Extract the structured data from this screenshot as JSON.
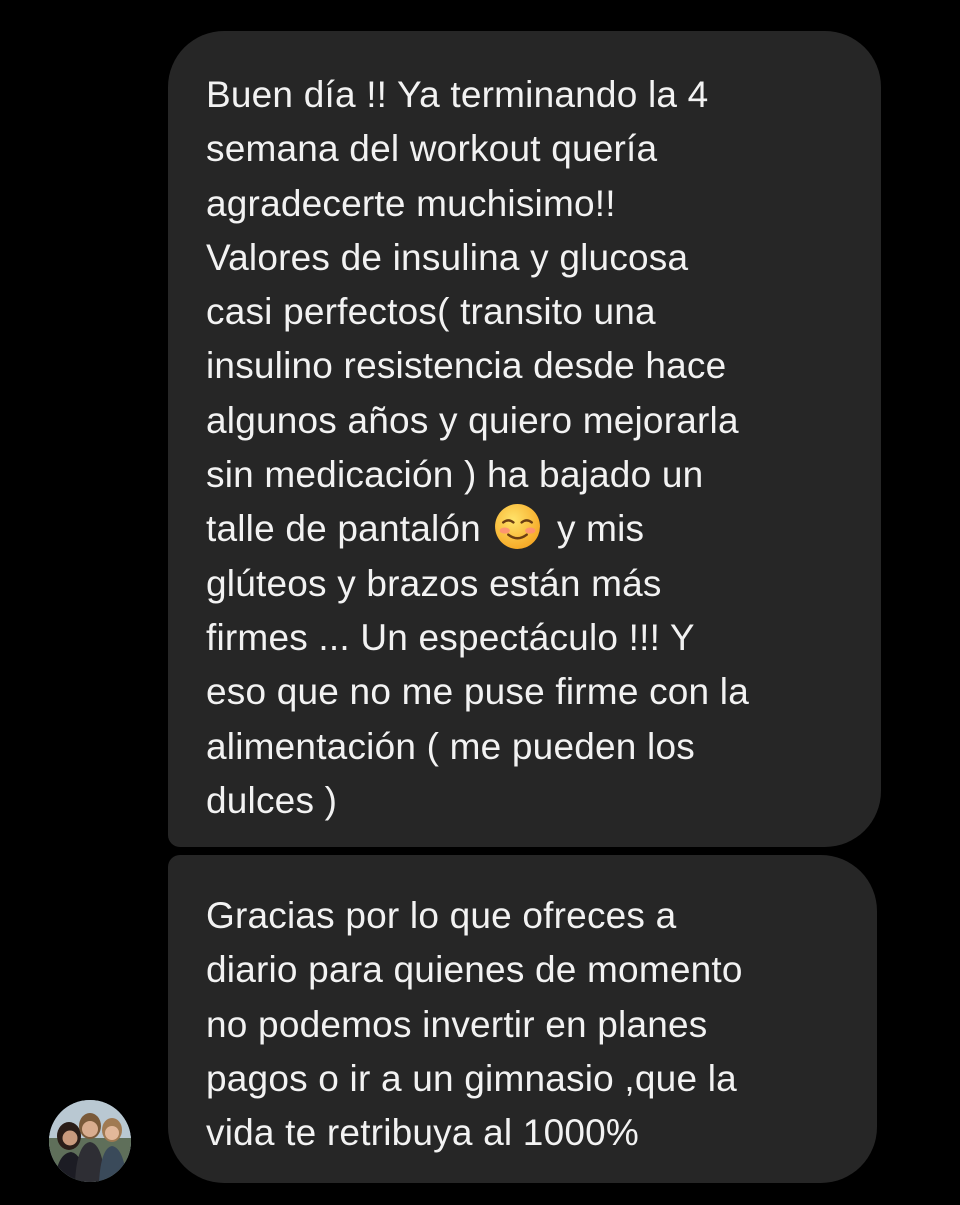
{
  "conversation": {
    "messages": [
      {
        "lines": [
          "Buen día !! Ya terminando la 4",
          "semana del workout quería",
          "agradecerte muchisimo!!",
          "Valores de insulina y glucosa",
          "casi perfectos( transito una",
          "insulino resistencia desde hace",
          "algunos años y quiero mejorarla",
          "sin medicación ) ha bajado un"
        ],
        "emoji_line_before": "talle de pantalón",
        "emoji_name": "smiling-face-emoji",
        "emoji_line_after": "y mis",
        "lines_after": [
          "glúteos y brazos están más",
          "firmes ... Un espectáculo !!! Y",
          "eso que no me puse firme con la",
          "alimentación ( me pueden los",
          "dulces )"
        ]
      },
      {
        "lines": [
          "Gracias por lo que ofreces a",
          "diario para quienes de momento",
          "no podemos invertir en planes",
          "pagos o ir a un gimnasio ,que la",
          "vida te retribuya al 1000%"
        ]
      }
    ],
    "avatar_icon": "user-avatar-photo"
  },
  "colors": {
    "background": "#000000",
    "bubble": "#262626",
    "text": "#f2f2f2"
  }
}
